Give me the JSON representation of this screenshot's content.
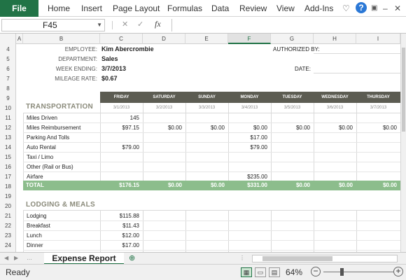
{
  "ribbon": {
    "file": "File",
    "tabs": [
      "Home",
      "Insert",
      "Page Layout",
      "Formulas",
      "Data",
      "Review",
      "View",
      "Add-Ins"
    ]
  },
  "formula_bar": {
    "name_box": "F45",
    "fx": "fx",
    "value": ""
  },
  "columns": [
    "A",
    "B",
    "C",
    "D",
    "E",
    "F",
    "G",
    "H",
    "I"
  ],
  "rows": [
    "4",
    "5",
    "6",
    "7",
    "8",
    "9",
    "10",
    "11",
    "12",
    "13",
    "14",
    "15",
    "16",
    "17",
    "18",
    "19",
    "20",
    "21",
    "22",
    "23",
    "24"
  ],
  "header": {
    "employee_label": "EMPLOYEE:",
    "employee": "Kim Abercrombie",
    "department_label": "DEPARTMENT:",
    "department": "Sales",
    "week_label": "WEEK ENDING:",
    "week": "3/7/2013",
    "rate_label": "MILEAGE RATE:",
    "rate": "$0.67",
    "authorized_label": "AUTHORIZED BY:",
    "date_label": "DATE:"
  },
  "days": [
    "FRIDAY",
    "SATURDAY",
    "SUNDAY",
    "MONDAY",
    "TUESDAY",
    "WEDNESDAY",
    "THURSDAY"
  ],
  "dates": [
    "3/1/2013",
    "3/2/2013",
    "3/3/2013",
    "3/4/2013",
    "3/5/2013",
    "3/6/2013",
    "3/7/2013"
  ],
  "transportation": {
    "title": "TRANSPORTATION",
    "items": [
      {
        "label": "Miles Driven",
        "values": [
          "145",
          "",
          "",
          "",
          "",
          "",
          ""
        ]
      },
      {
        "label": "Miles Reimbursement",
        "values": [
          "$97.15",
          "$0.00",
          "$0.00",
          "$0.00",
          "$0.00",
          "$0.00",
          "$0.00"
        ]
      },
      {
        "label": "Parking And Tolls",
        "values": [
          "",
          "",
          "",
          "$17.00",
          "",
          "",
          ""
        ]
      },
      {
        "label": "Auto Rental",
        "values": [
          "$79.00",
          "",
          "",
          "$79.00",
          "",
          "",
          ""
        ]
      },
      {
        "label": "Taxi / Limo",
        "values": [
          "",
          "",
          "",
          "",
          "",
          "",
          ""
        ]
      },
      {
        "label": "Other (Rail or Bus)",
        "values": [
          "",
          "",
          "",
          "",
          "",
          "",
          ""
        ]
      },
      {
        "label": "Airfare",
        "values": [
          "",
          "",
          "",
          "$235.00",
          "",
          "",
          ""
        ]
      }
    ],
    "total_label": "TOTAL",
    "totals": [
      "$176.15",
      "$0.00",
      "$0.00",
      "$331.00",
      "$0.00",
      "$0.00",
      "$0.00"
    ]
  },
  "lodging": {
    "title": "LODGING & MEALS",
    "items": [
      {
        "label": "Lodging",
        "values": [
          "$115.88",
          "",
          "",
          "",
          "",
          "",
          ""
        ]
      },
      {
        "label": "Breakfast",
        "values": [
          "$11.43",
          "",
          "",
          "",
          "",
          "",
          ""
        ]
      },
      {
        "label": "Lunch",
        "values": [
          "$12.00",
          "",
          "",
          "",
          "",
          "",
          ""
        ]
      },
      {
        "label": "Dinner",
        "values": [
          "$17.00",
          "",
          "",
          "",
          "",
          "",
          ""
        ]
      }
    ]
  },
  "sheet_tab": "Expense Report",
  "status": {
    "ready": "Ready",
    "zoom": "64%"
  },
  "colors": {
    "excel_green": "#217346",
    "header_dark": "#5c5c52",
    "total_green": "#8cbd8c"
  }
}
